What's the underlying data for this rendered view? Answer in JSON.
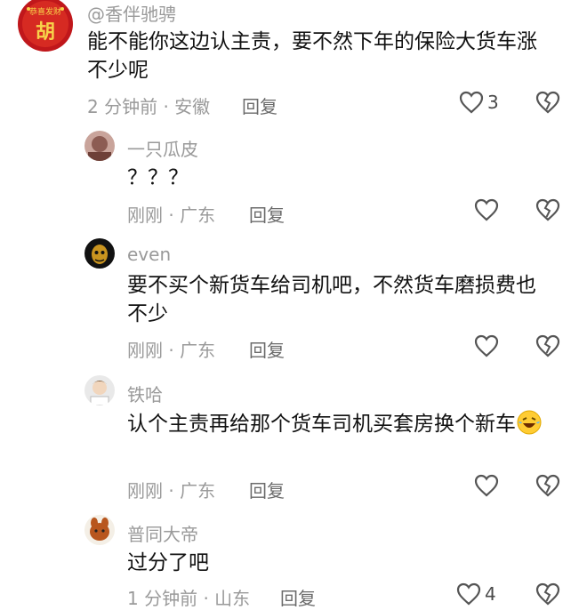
{
  "comments": [
    {
      "name": "@香伴驰骋",
      "avatar_glyph": "胡",
      "avatar_top_text": "恭喜发财",
      "text": "能不能你这边认主责，要不然下年的保险大货车涨不少呢",
      "time_location": "2 分钟前 · 安徽",
      "reply_label": "回复",
      "likes": "3"
    },
    {
      "name": "一只瓜皮",
      "text": "？？？",
      "time_location": "刚刚 · 广东",
      "reply_label": "回复",
      "likes": ""
    },
    {
      "name": "even",
      "text": "要不买个新货车给司机吧，不然货车磨损费也不少",
      "time_location": "刚刚 · 广东",
      "reply_label": "回复",
      "likes": ""
    },
    {
      "name": "铁哈",
      "text": "认个主责再给那个货车司机买套房换个新车",
      "emoji": "rofl-emoji",
      "time_location": "刚刚 · 广东",
      "reply_label": "回复",
      "likes": ""
    },
    {
      "name": "普同大帝",
      "text": "过分了吧",
      "time_location": "1 分钟前 · 山东",
      "reply_label": "回复",
      "likes": "4"
    }
  ],
  "icons": {
    "like": "heart-outline-icon",
    "dislike": "broken-heart-icon"
  },
  "colors": {
    "avatar_red": "#c0171b",
    "meta_gray": "#9a9a9a",
    "text": "#111111"
  }
}
